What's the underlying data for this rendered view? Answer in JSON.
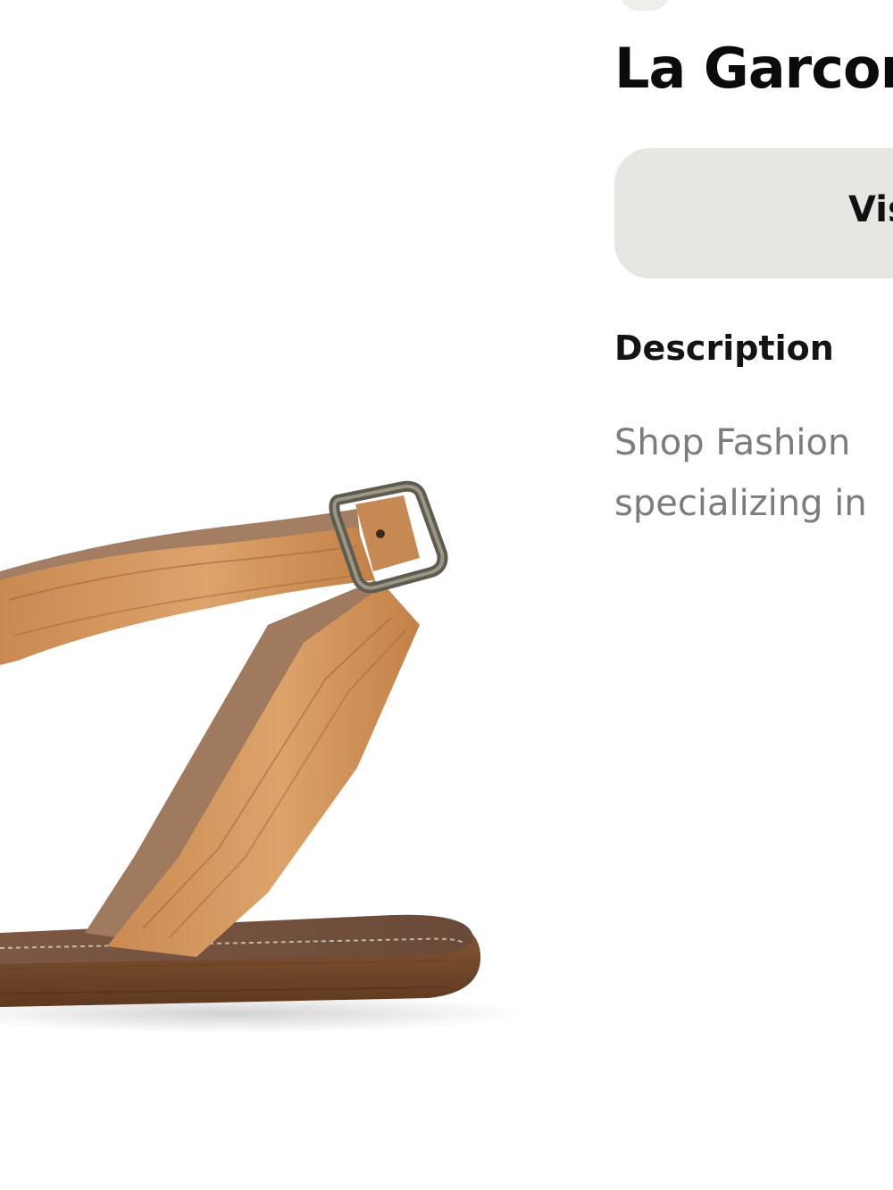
{
  "product": {
    "title": "La Garcon",
    "visit_label": "Vis",
    "image_alt": "Tan leather ankle-strap sandal with metal buckle"
  },
  "description": {
    "heading": "Description",
    "lines": [
      "Shop Fashion",
      "specializing in"
    ]
  },
  "colors": {
    "leather": "#c98a52",
    "sole": "#7a4a2a",
    "button_bg": "#e6e6e2",
    "description_text": "#7c7c7c"
  }
}
